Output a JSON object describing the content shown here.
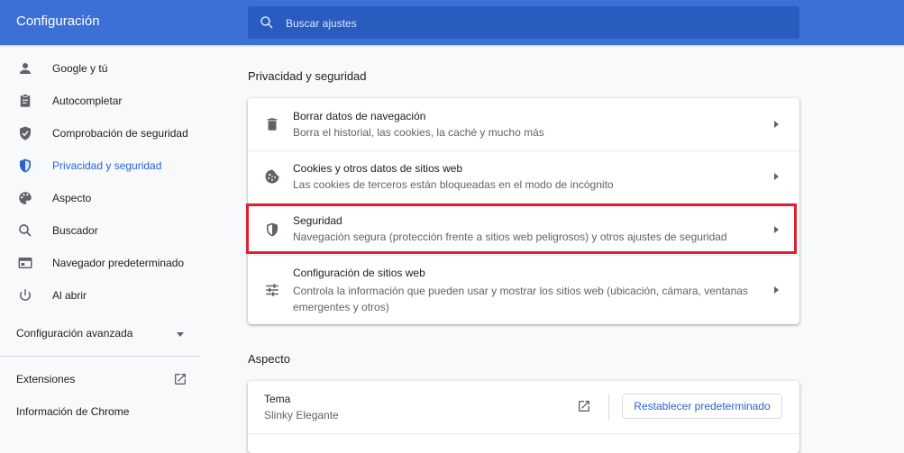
{
  "header": {
    "title": "Configuración",
    "search_placeholder": "Buscar ajustes"
  },
  "sidebar": {
    "items": [
      {
        "label": "Google y tú",
        "icon": "person-icon"
      },
      {
        "label": "Autocompletar",
        "icon": "clipboard-icon"
      },
      {
        "label": "Comprobación de seguridad",
        "icon": "shield-check-icon"
      },
      {
        "label": "Privacidad y seguridad",
        "icon": "shield-icon",
        "active": true
      },
      {
        "label": "Aspecto",
        "icon": "palette-icon"
      },
      {
        "label": "Buscador",
        "icon": "search-icon"
      },
      {
        "label": "Navegador predeterminado",
        "icon": "browser-icon"
      },
      {
        "label": "Al abrir",
        "icon": "power-icon"
      }
    ],
    "advanced_label": "Configuración avanzada",
    "extensions_label": "Extensiones",
    "about_label": "Información de Chrome"
  },
  "privacy": {
    "section_title": "Privacidad y seguridad",
    "rows": [
      {
        "title": "Borrar datos de navegación",
        "subtitle": "Borra el historial, las cookies, la caché y mucho más",
        "icon": "trash-icon"
      },
      {
        "title": "Cookies y otros datos de sitios web",
        "subtitle": "Las cookies de terceros están bloqueadas en el modo de incógnito",
        "icon": "cookie-icon"
      },
      {
        "title": "Seguridad",
        "subtitle": "Navegación segura (protección frente a sitios web peligrosos) y otros ajustes de seguridad",
        "icon": "shield-icon"
      },
      {
        "title": "Configuración de sitios web",
        "subtitle": "Controla la información que pueden usar y mostrar los sitios web (ubicación, cámara, ventanas emergentes y otros)",
        "icon": "sliders-icon"
      }
    ]
  },
  "appearance": {
    "section_title": "Aspecto",
    "theme_title": "Tema",
    "theme_value": "Slinky Elegante",
    "reset_label": "Restablecer predeterminado"
  },
  "colors": {
    "header_bg": "#3c70d6",
    "accent": "#2962d6",
    "highlight_border": "#e0202e"
  }
}
